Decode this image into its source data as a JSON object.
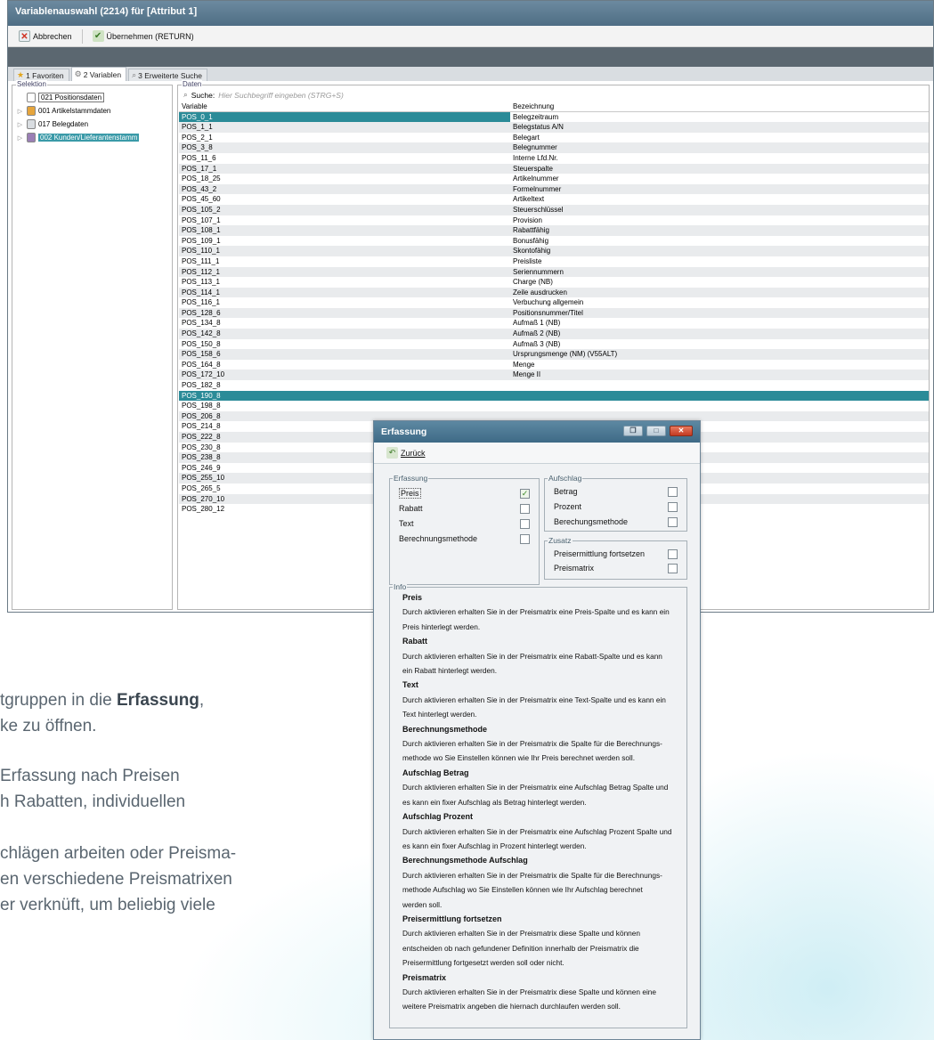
{
  "background_text": {
    "p1_line1_pre": "tgruppen in die ",
    "p1_line1_bold": "Erfassung",
    "p1_line1_post": ",",
    "p1_line2": "ke zu öffnen.",
    "p2_line1": "Erfassung nach Preisen",
    "p2_line2": "h Rabatten, individuellen",
    "p3_line1": "chlägen arbeiten oder Preisma-",
    "p3_line2": "en verschiedene Preismatrixen",
    "p3_line3": "er verknüft, um beliebig viele"
  },
  "main_window": {
    "title": "Variablenauswahl (2214) für [Attribut 1]",
    "toolbar": {
      "cancel_label": "Abbrechen",
      "apply_label": "Übernehmen (RETURN)"
    },
    "tabs": [
      "1 Favoriten",
      "2 Variablen",
      "3 Erweiterte Suche"
    ],
    "selektion_label": "Selektion",
    "tree": [
      {
        "label": "021 Positionsdaten",
        "state": "first"
      },
      {
        "label": "001 Artikelstammdaten",
        "state": "normal"
      },
      {
        "label": "017 Belegdaten",
        "state": "normal"
      },
      {
        "label": "002 Kunden/Lieferantenstamm",
        "state": "selected"
      }
    ],
    "daten_label": "Daten",
    "search_label": "Suche:",
    "search_placeholder": "Hier Suchbegriff eingeben (STRG+S)",
    "columns": [
      "Variable",
      "Bezeichnung"
    ],
    "rows": [
      [
        "POS_0_1",
        "Belegzeitraum"
      ],
      [
        "POS_1_1",
        "Belegstatus A/N"
      ],
      [
        "POS_2_1",
        "Belegart"
      ],
      [
        "POS_3_8",
        "Belegnummer"
      ],
      [
        "POS_11_6",
        "Interne Lfd.Nr."
      ],
      [
        "POS_17_1",
        "Steuerspalte"
      ],
      [
        "POS_18_25",
        "Artikelnummer"
      ],
      [
        "POS_43_2",
        "Formelnummer"
      ],
      [
        "POS_45_60",
        "Artikeltext"
      ],
      [
        "POS_105_2",
        "Steuerschlüssel"
      ],
      [
        "POS_107_1",
        "Provision"
      ],
      [
        "POS_108_1",
        "Rabattfähig"
      ],
      [
        "POS_109_1",
        "Bonusfähig"
      ],
      [
        "POS_110_1",
        "Skontofähig"
      ],
      [
        "POS_111_1",
        "Preisliste"
      ],
      [
        "POS_112_1",
        "Seriennummern"
      ],
      [
        "POS_113_1",
        "Charge (NB)"
      ],
      [
        "POS_114_1",
        "Zeile ausdrucken"
      ],
      [
        "POS_116_1",
        "Verbuchung allgemein"
      ],
      [
        "POS_128_6",
        "Positionsnummer/Titel"
      ],
      [
        "POS_134_8",
        "Aufmaß 1 (NB)"
      ],
      [
        "POS_142_8",
        "Aufmaß 2 (NB)"
      ],
      [
        "POS_150_8",
        "Aufmaß 3 (NB)"
      ],
      [
        "POS_158_6",
        "Ursprungsmenge (NM) (V55ALT)"
      ],
      [
        "POS_164_8",
        "Menge"
      ],
      [
        "POS_172_10",
        "Menge II"
      ],
      [
        "POS_182_8",
        ""
      ],
      [
        "POS_190_8",
        ""
      ],
      [
        "POS_198_8",
        ""
      ],
      [
        "POS_206_8",
        ""
      ],
      [
        "POS_214_8",
        ""
      ],
      [
        "POS_222_8",
        ""
      ],
      [
        "POS_230_8",
        ""
      ],
      [
        "POS_238_8",
        ""
      ],
      [
        "POS_246_9",
        ""
      ],
      [
        "POS_255_10",
        ""
      ],
      [
        "POS_265_5",
        ""
      ],
      [
        "POS_270_10",
        ""
      ],
      [
        "POS_280_12",
        ""
      ]
    ],
    "selected_rows": [
      "POS_0_1",
      "POS_190_8"
    ]
  },
  "dialog": {
    "title": "Erfassung",
    "back_label": "Zurück",
    "erfassung_group": {
      "label": "Erfassung",
      "options": [
        {
          "label": "Preis",
          "checked": true
        },
        {
          "label": "Rabatt",
          "checked": false
        },
        {
          "label": "Text",
          "checked": false
        },
        {
          "label": "Berechnungsmethode",
          "checked": false
        }
      ]
    },
    "aufschlag_group": {
      "label": "Aufschlag",
      "options": [
        {
          "label": "Betrag",
          "checked": false
        },
        {
          "label": "Prozent",
          "checked": false
        },
        {
          "label": "Berechungsmethode",
          "checked": false
        }
      ]
    },
    "zusatz_group": {
      "label": "Zusatz",
      "options": [
        {
          "label": "Preisermittlung fortsetzen",
          "checked": false
        },
        {
          "label": "Preismatrix",
          "checked": false
        }
      ]
    },
    "info_label": "Info",
    "info": [
      {
        "heading": "Preis",
        "lines": [
          "Durch aktivieren erhalten Sie in der Preismatrix eine Preis-Spalte und es kann ein",
          "Preis hinterlegt werden."
        ]
      },
      {
        "heading": "Rabatt",
        "lines": [
          "Durch aktivieren erhalten Sie in der Preismatrix eine Rabatt-Spalte und es kann",
          "ein Rabatt hinterlegt werden."
        ]
      },
      {
        "heading": "Text",
        "lines": [
          "Durch aktivieren erhalten Sie in der Preismatrix eine Text-Spalte und es kann ein",
          "Text hinterlegt werden."
        ]
      },
      {
        "heading": "Berechnungsmethode",
        "lines": [
          "Durch aktivieren erhalten Sie in der Preismatrix die Spalte für die Berechnungs-",
          "methode wo Sie Einstellen können wie Ihr Preis berechnet werden soll."
        ]
      },
      {
        "heading": "Aufschlag Betrag",
        "lines": [
          "Durch aktivieren erhalten Sie in der Preismatrix eine Aufschlag Betrag Spalte und",
          "es kann ein fixer Aufschlag als Betrag hinterlegt werden."
        ]
      },
      {
        "heading": "Aufschlag Prozent",
        "lines": [
          "Durch aktivieren erhalten Sie in der Preismatrix eine Aufschlag Prozent Spalte und",
          "es kann ein fixer Aufschlag in Prozent hinterlegt werden."
        ]
      },
      {
        "heading": "Berechnungsmethode Aufschlag",
        "lines": [
          "Durch aktivieren erhalten Sie in der Preismatrix die Spalte für die Berechnungs-",
          "methode Aufschlag wo Sie Einstellen können wie Ihr Aufschlag berechnet",
          "werden soll."
        ]
      },
      {
        "heading": "Preisermittlung fortsetzen",
        "lines": [
          "Durch aktivieren erhalten Sie in der Preismatrix diese Spalte und können",
          "entscheiden ob nach gefundener Definition innerhalb der Preismatrix die",
          "Preisermittlung fortgesetzt werden soll oder nicht."
        ]
      },
      {
        "heading": "Preismatrix",
        "lines": [
          "Durch aktivieren erhalten Sie in der Preismatrix diese Spalte und können eine",
          "weitere Preismatrix angeben die hiernach durchlaufen werden soll."
        ]
      }
    ]
  },
  "colors": {
    "accent": "#2b8b98",
    "title_bar": "#4e6d84",
    "checkbox_check": "#3a8a26"
  }
}
